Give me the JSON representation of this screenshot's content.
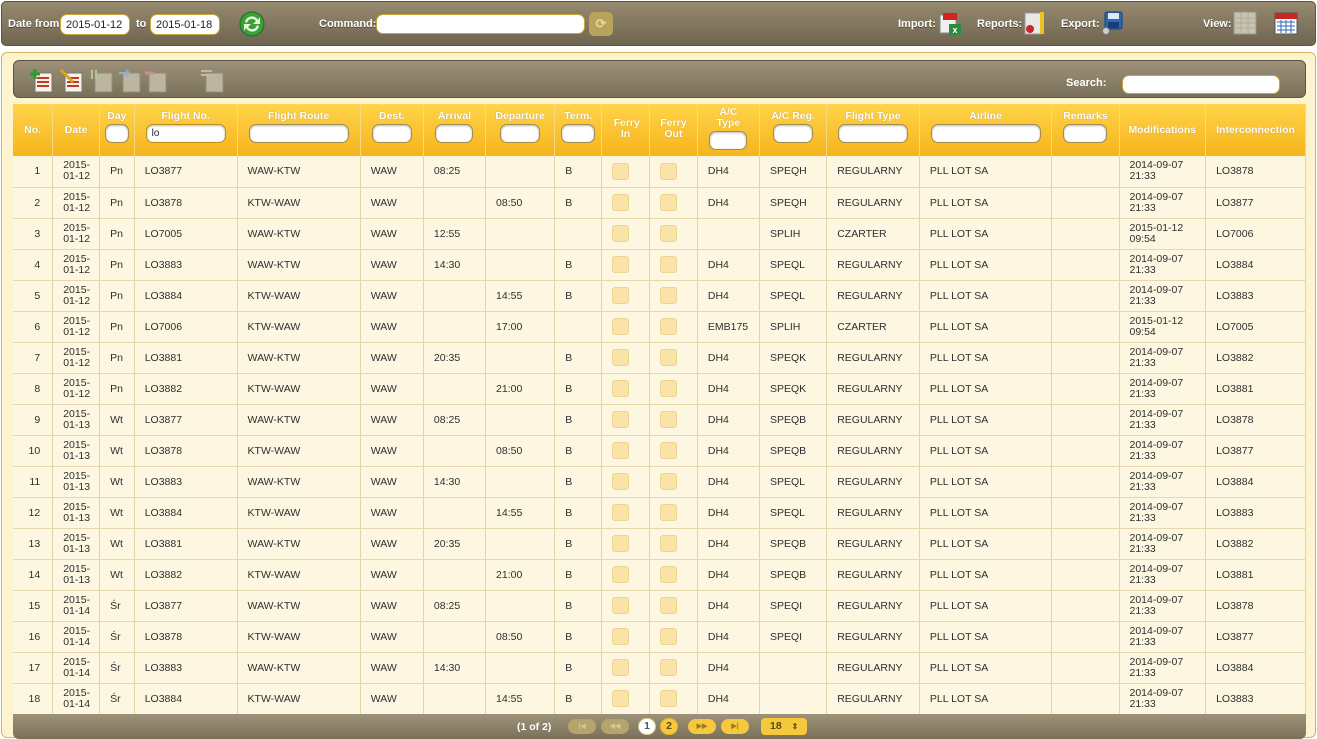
{
  "topbar": {
    "date_from_label": "Date from",
    "date_from": "2015-01-12",
    "to_label": "to",
    "date_to": "2015-01-18",
    "command_label": "Command:",
    "command_value": "",
    "import_label": "Import:",
    "reports_label": "Reports:",
    "export_label": "Export:",
    "view_label": "View:"
  },
  "search": {
    "label": "Search:",
    "value": ""
  },
  "columns": {
    "no": "No.",
    "date": "Date",
    "day": "Day",
    "flight_no": "Flight No.",
    "route": "Flight Route",
    "dest": "Dest.",
    "arrival": "Arrival",
    "departure": "Departure",
    "term": "Term.",
    "ferry_in": "Ferry In",
    "ferry_out": "Ferry Out",
    "ac_type": "A/C Type",
    "ac_reg": "A/C Reg.",
    "flight_type": "Flight Type",
    "airline": "Airline",
    "remarks": "Remarks",
    "modifications": "Modifications",
    "interconnection": "Interconnection"
  },
  "filters": {
    "flight_no": "lo"
  },
  "rows": [
    {
      "no": "1",
      "date": "2015-01-12",
      "day": "Pn",
      "flight": "LO3877",
      "route": "WAW-KTW",
      "dest": "WAW",
      "arr": "08:25",
      "dep": "",
      "term": "B",
      "ac_type": "DH4",
      "ac_reg": "SPEQH",
      "ftype": "REGULARNY",
      "airline": "PLL LOT SA",
      "remarks": "",
      "mod": "2014-09-07 21:33",
      "inter": "LO3878"
    },
    {
      "no": "2",
      "date": "2015-01-12",
      "day": "Pn",
      "flight": "LO3878",
      "route": "KTW-WAW",
      "dest": "WAW",
      "arr": "",
      "dep": "08:50",
      "term": "B",
      "ac_type": "DH4",
      "ac_reg": "SPEQH",
      "ftype": "REGULARNY",
      "airline": "PLL LOT SA",
      "remarks": "",
      "mod": "2014-09-07 21:33",
      "inter": "LO3877"
    },
    {
      "no": "3",
      "date": "2015-01-12",
      "day": "Pn",
      "flight": "LO7005",
      "route": "WAW-KTW",
      "dest": "WAW",
      "arr": "12:55",
      "dep": "",
      "term": "",
      "ac_type": "",
      "ac_reg": "SPLIH",
      "ftype": "CZARTER",
      "airline": "PLL LOT SA",
      "remarks": "",
      "mod": "2015-01-12 09:54",
      "inter": "LO7006"
    },
    {
      "no": "4",
      "date": "2015-01-12",
      "day": "Pn",
      "flight": "LO3883",
      "route": "WAW-KTW",
      "dest": "WAW",
      "arr": "14:30",
      "dep": "",
      "term": "B",
      "ac_type": "DH4",
      "ac_reg": "SPEQL",
      "ftype": "REGULARNY",
      "airline": "PLL LOT SA",
      "remarks": "",
      "mod": "2014-09-07 21:33",
      "inter": "LO3884"
    },
    {
      "no": "5",
      "date": "2015-01-12",
      "day": "Pn",
      "flight": "LO3884",
      "route": "KTW-WAW",
      "dest": "WAW",
      "arr": "",
      "dep": "14:55",
      "term": "B",
      "ac_type": "DH4",
      "ac_reg": "SPEQL",
      "ftype": "REGULARNY",
      "airline": "PLL LOT SA",
      "remarks": "",
      "mod": "2014-09-07 21:33",
      "inter": "LO3883"
    },
    {
      "no": "6",
      "date": "2015-01-12",
      "day": "Pn",
      "flight": "LO7006",
      "route": "KTW-WAW",
      "dest": "WAW",
      "arr": "",
      "dep": "17:00",
      "term": "",
      "ac_type": "EMB175",
      "ac_reg": "SPLIH",
      "ftype": "CZARTER",
      "airline": "PLL LOT SA",
      "remarks": "",
      "mod": "2015-01-12 09:54",
      "inter": "LO7005"
    },
    {
      "no": "7",
      "date": "2015-01-12",
      "day": "Pn",
      "flight": "LO3881",
      "route": "WAW-KTW",
      "dest": "WAW",
      "arr": "20:35",
      "dep": "",
      "term": "B",
      "ac_type": "DH4",
      "ac_reg": "SPEQK",
      "ftype": "REGULARNY",
      "airline": "PLL LOT SA",
      "remarks": "",
      "mod": "2014-09-07 21:33",
      "inter": "LO3882"
    },
    {
      "no": "8",
      "date": "2015-01-12",
      "day": "Pn",
      "flight": "LO3882",
      "route": "KTW-WAW",
      "dest": "WAW",
      "arr": "",
      "dep": "21:00",
      "term": "B",
      "ac_type": "DH4",
      "ac_reg": "SPEQK",
      "ftype": "REGULARNY",
      "airline": "PLL LOT SA",
      "remarks": "",
      "mod": "2014-09-07 21:33",
      "inter": "LO3881"
    },
    {
      "no": "9",
      "date": "2015-01-13",
      "day": "Wt",
      "flight": "LO3877",
      "route": "WAW-KTW",
      "dest": "WAW",
      "arr": "08:25",
      "dep": "",
      "term": "B",
      "ac_type": "DH4",
      "ac_reg": "SPEQB",
      "ftype": "REGULARNY",
      "airline": "PLL LOT SA",
      "remarks": "",
      "mod": "2014-09-07 21:33",
      "inter": "LO3878"
    },
    {
      "no": "10",
      "date": "2015-01-13",
      "day": "Wt",
      "flight": "LO3878",
      "route": "KTW-WAW",
      "dest": "WAW",
      "arr": "",
      "dep": "08:50",
      "term": "B",
      "ac_type": "DH4",
      "ac_reg": "SPEQB",
      "ftype": "REGULARNY",
      "airline": "PLL LOT SA",
      "remarks": "",
      "mod": "2014-09-07 21:33",
      "inter": "LO3877"
    },
    {
      "no": "11",
      "date": "2015-01-13",
      "day": "Wt",
      "flight": "LO3883",
      "route": "WAW-KTW",
      "dest": "WAW",
      "arr": "14:30",
      "dep": "",
      "term": "B",
      "ac_type": "DH4",
      "ac_reg": "SPEQL",
      "ftype": "REGULARNY",
      "airline": "PLL LOT SA",
      "remarks": "",
      "mod": "2014-09-07 21:33",
      "inter": "LO3884"
    },
    {
      "no": "12",
      "date": "2015-01-13",
      "day": "Wt",
      "flight": "LO3884",
      "route": "KTW-WAW",
      "dest": "WAW",
      "arr": "",
      "dep": "14:55",
      "term": "B",
      "ac_type": "DH4",
      "ac_reg": "SPEQL",
      "ftype": "REGULARNY",
      "airline": "PLL LOT SA",
      "remarks": "",
      "mod": "2014-09-07 21:33",
      "inter": "LO3883"
    },
    {
      "no": "13",
      "date": "2015-01-13",
      "day": "Wt",
      "flight": "LO3881",
      "route": "WAW-KTW",
      "dest": "WAW",
      "arr": "20:35",
      "dep": "",
      "term": "B",
      "ac_type": "DH4",
      "ac_reg": "SPEQB",
      "ftype": "REGULARNY",
      "airline": "PLL LOT SA",
      "remarks": "",
      "mod": "2014-09-07 21:33",
      "inter": "LO3882"
    },
    {
      "no": "14",
      "date": "2015-01-13",
      "day": "Wt",
      "flight": "LO3882",
      "route": "KTW-WAW",
      "dest": "WAW",
      "arr": "",
      "dep": "21:00",
      "term": "B",
      "ac_type": "DH4",
      "ac_reg": "SPEQB",
      "ftype": "REGULARNY",
      "airline": "PLL LOT SA",
      "remarks": "",
      "mod": "2014-09-07 21:33",
      "inter": "LO3881"
    },
    {
      "no": "15",
      "date": "2015-01-14",
      "day": "Śr",
      "flight": "LO3877",
      "route": "WAW-KTW",
      "dest": "WAW",
      "arr": "08:25",
      "dep": "",
      "term": "B",
      "ac_type": "DH4",
      "ac_reg": "SPEQI",
      "ftype": "REGULARNY",
      "airline": "PLL LOT SA",
      "remarks": "",
      "mod": "2014-09-07 21:33",
      "inter": "LO3878"
    },
    {
      "no": "16",
      "date": "2015-01-14",
      "day": "Śr",
      "flight": "LO3878",
      "route": "KTW-WAW",
      "dest": "WAW",
      "arr": "",
      "dep": "08:50",
      "term": "B",
      "ac_type": "DH4",
      "ac_reg": "SPEQI",
      "ftype": "REGULARNY",
      "airline": "PLL LOT SA",
      "remarks": "",
      "mod": "2014-09-07 21:33",
      "inter": "LO3877"
    },
    {
      "no": "17",
      "date": "2015-01-14",
      "day": "Śr",
      "flight": "LO3883",
      "route": "WAW-KTW",
      "dest": "WAW",
      "arr": "14:30",
      "dep": "",
      "term": "B",
      "ac_type": "DH4",
      "ac_reg": "",
      "ftype": "REGULARNY",
      "airline": "PLL LOT SA",
      "remarks": "",
      "mod": "2014-09-07 21:33",
      "inter": "LO3884"
    },
    {
      "no": "18",
      "date": "2015-01-14",
      "day": "Śr",
      "flight": "LO3884",
      "route": "KTW-WAW",
      "dest": "WAW",
      "arr": "",
      "dep": "14:55",
      "term": "B",
      "ac_type": "DH4",
      "ac_reg": "",
      "ftype": "REGULARNY",
      "airline": "PLL LOT SA",
      "remarks": "",
      "mod": "2014-09-07 21:33",
      "inter": "LO3883"
    }
  ],
  "pager": {
    "info": "(1 of 2)",
    "first": "|◀",
    "prev": "◀◀",
    "next": "▶▶",
    "last": "▶|",
    "pages": [
      "1",
      "2"
    ],
    "page_size": "18"
  },
  "icons": {
    "refresh": "refresh-icon",
    "run": "run-command-icon",
    "import": "import-excel-icon",
    "reports": "reports-icon",
    "export": "export-disk-icon",
    "view_grid": "grid-view-icon",
    "view_calendar": "calendar-view-icon",
    "add": "add-record-icon",
    "edit": "edit-record-icon",
    "copy": "copy-icon",
    "paste": "paste-icon",
    "delete": "delete-icon",
    "columns": "columns-icon"
  },
  "colors": {
    "header": "#f6b51c",
    "row": "#fdf7e2",
    "bar": "#7a6f58",
    "border": "#d6b558"
  }
}
